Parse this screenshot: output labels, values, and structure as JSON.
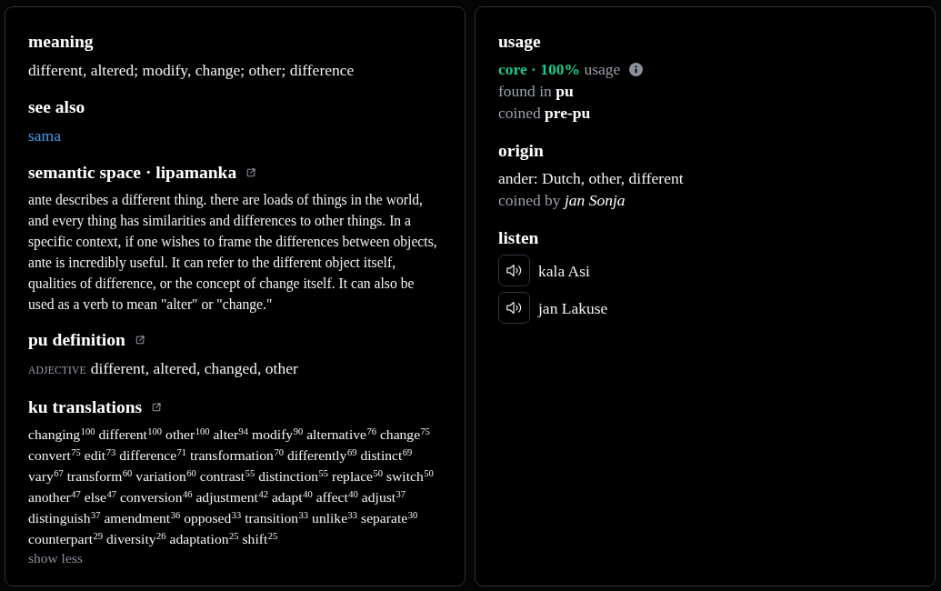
{
  "left_panel": {
    "sections": [
      {
        "kind": "text",
        "heading": "meaning",
        "external_link": false,
        "text": "different, altered; modify, change; other; difference"
      },
      {
        "kind": "links",
        "heading": "see also",
        "external_link": false,
        "links": [
          "sama"
        ]
      },
      {
        "kind": "paragraph",
        "heading": "semantic space · lipamanka",
        "external_link": true,
        "text": "ante describes a different thing. there are loads of things in the world, and every thing has similarities and differences to other things. In a specific context, if one wishes to frame the differences between objects, ante is incredibly useful. It can refer to the different object itself, qualities of difference, or the concept of change itself. It can also be used as a verb to mean \"alter\" or \"change.\""
      },
      {
        "kind": "definition",
        "heading": "pu definition",
        "external_link": true,
        "part_of_speech": "ADJECTIVE",
        "text": "different, altered, changed, other"
      },
      {
        "kind": "translations",
        "heading": "ku translations",
        "external_link": true,
        "terms": [
          {
            "word": "changing",
            "count": "100"
          },
          {
            "word": "different",
            "count": "100"
          },
          {
            "word": "other",
            "count": "100"
          },
          {
            "word": "alter",
            "count": "94"
          },
          {
            "word": "modify",
            "count": "90"
          },
          {
            "word": "alternative",
            "count": "76"
          },
          {
            "word": "change",
            "count": "75"
          },
          {
            "word": "convert",
            "count": "75"
          },
          {
            "word": "edit",
            "count": "73"
          },
          {
            "word": "difference",
            "count": "71"
          },
          {
            "word": "transformation",
            "count": "70"
          },
          {
            "word": "differently",
            "count": "69"
          },
          {
            "word": "distinct",
            "count": "69"
          },
          {
            "word": "vary",
            "count": "67"
          },
          {
            "word": "transform",
            "count": "60"
          },
          {
            "word": "variation",
            "count": "60"
          },
          {
            "word": "contrast",
            "count": "55"
          },
          {
            "word": "distinction",
            "count": "55"
          },
          {
            "word": "replace",
            "count": "50"
          },
          {
            "word": "switch",
            "count": "50"
          },
          {
            "word": "another",
            "count": "47"
          },
          {
            "word": "else",
            "count": "47"
          },
          {
            "word": "conversion",
            "count": "46"
          },
          {
            "word": "adjustment",
            "count": "42"
          },
          {
            "word": "adapt",
            "count": "40"
          },
          {
            "word": "affect",
            "count": "40"
          },
          {
            "word": "adjust",
            "count": "37"
          },
          {
            "word": "distinguish",
            "count": "37"
          },
          {
            "word": "amendment",
            "count": "36"
          },
          {
            "word": "opposed",
            "count": "33"
          },
          {
            "word": "transition",
            "count": "33"
          },
          {
            "word": "unlike",
            "count": "33"
          },
          {
            "word": "separate",
            "count": "30"
          },
          {
            "word": "counterpart",
            "count": "29"
          },
          {
            "word": "diversity",
            "count": "26"
          },
          {
            "word": "adaptation",
            "count": "25"
          },
          {
            "word": "shift",
            "count": "25"
          }
        ],
        "toggle": "show less"
      }
    ]
  },
  "right_panel": {
    "sections": [
      {
        "kind": "facts",
        "heading": "usage",
        "lines": [
          {
            "kind": "rating",
            "text": "**core · 100%** usage"
          },
          {
            "kind": "fact",
            "text": "found in **pu**"
          },
          {
            "kind": "fact",
            "text": "coined **pre-pu**"
          }
        ]
      },
      {
        "kind": "facts",
        "heading": "origin",
        "lines": [
          {
            "kind": "plain",
            "text": "ander: Dutch, other, different"
          },
          {
            "kind": "fact",
            "text": "coined by *jan Sonja*"
          }
        ]
      },
      {
        "kind": "audio",
        "heading": "listen",
        "recordings": [
          {
            "speaker": "kala Asi"
          },
          {
            "speaker": "jan Lakuse"
          }
        ]
      }
    ]
  }
}
